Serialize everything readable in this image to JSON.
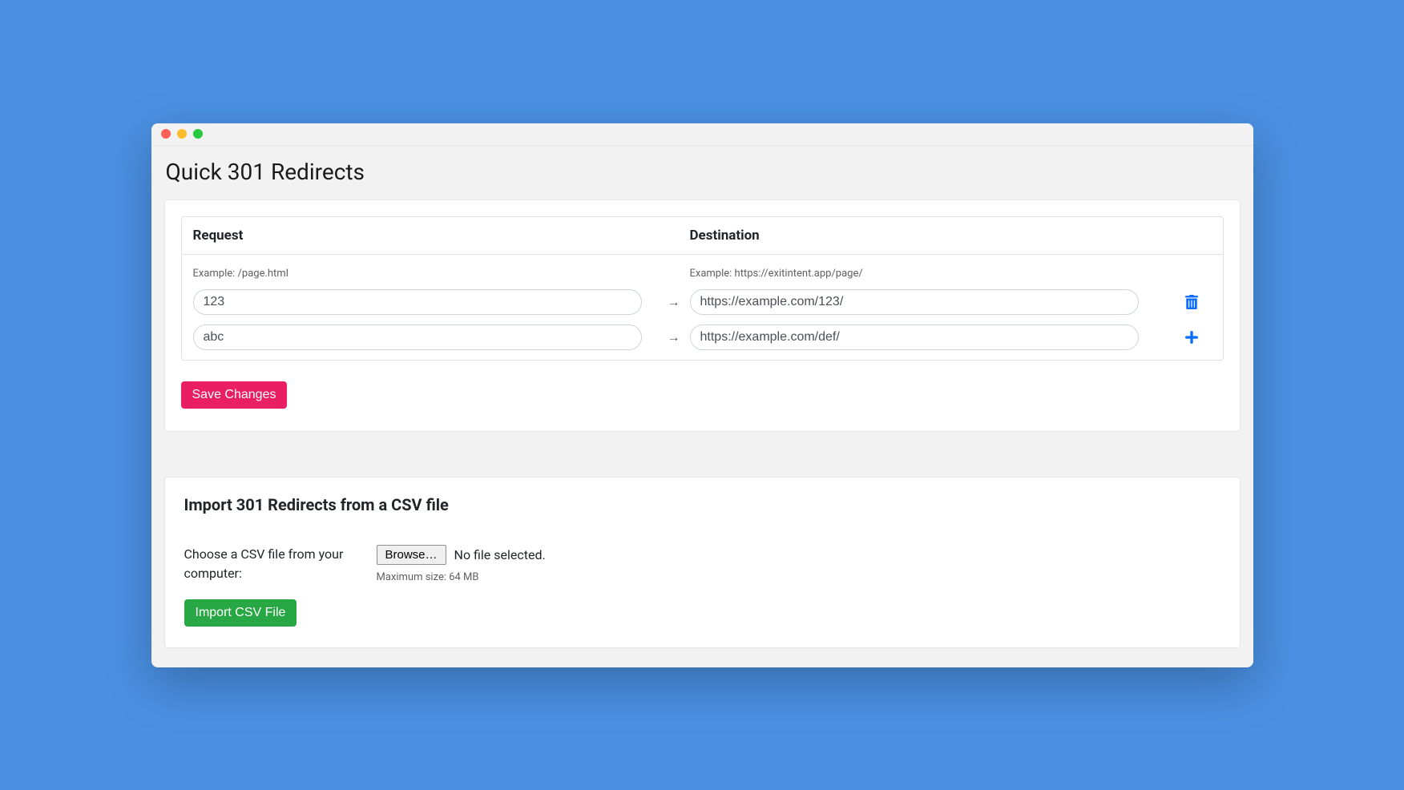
{
  "page_title": "Quick 301 Redirects",
  "table": {
    "headers": {
      "request": "Request",
      "destination": "Destination"
    },
    "hints": {
      "request": "Example: /page.html",
      "destination": "Example: https://exitintent.app/page/"
    },
    "rows": [
      {
        "request": "123",
        "destination": "https://example.com/123/"
      },
      {
        "request": "abc",
        "destination": "https://example.com/def/"
      }
    ],
    "arrow": "→"
  },
  "save_button": "Save Changes",
  "import": {
    "title": "Import 301 Redirects from a CSV file",
    "label": "Choose a CSV file from your computer:",
    "browse_button": "Browse…",
    "no_file_text": "No file selected.",
    "max_size": "Maximum size: 64 MB",
    "import_button": "Import CSV File"
  },
  "colors": {
    "background": "#4a90e2",
    "primary_pink": "#e91e63",
    "primary_green": "#28a745",
    "icon_blue": "#0d6efd"
  }
}
